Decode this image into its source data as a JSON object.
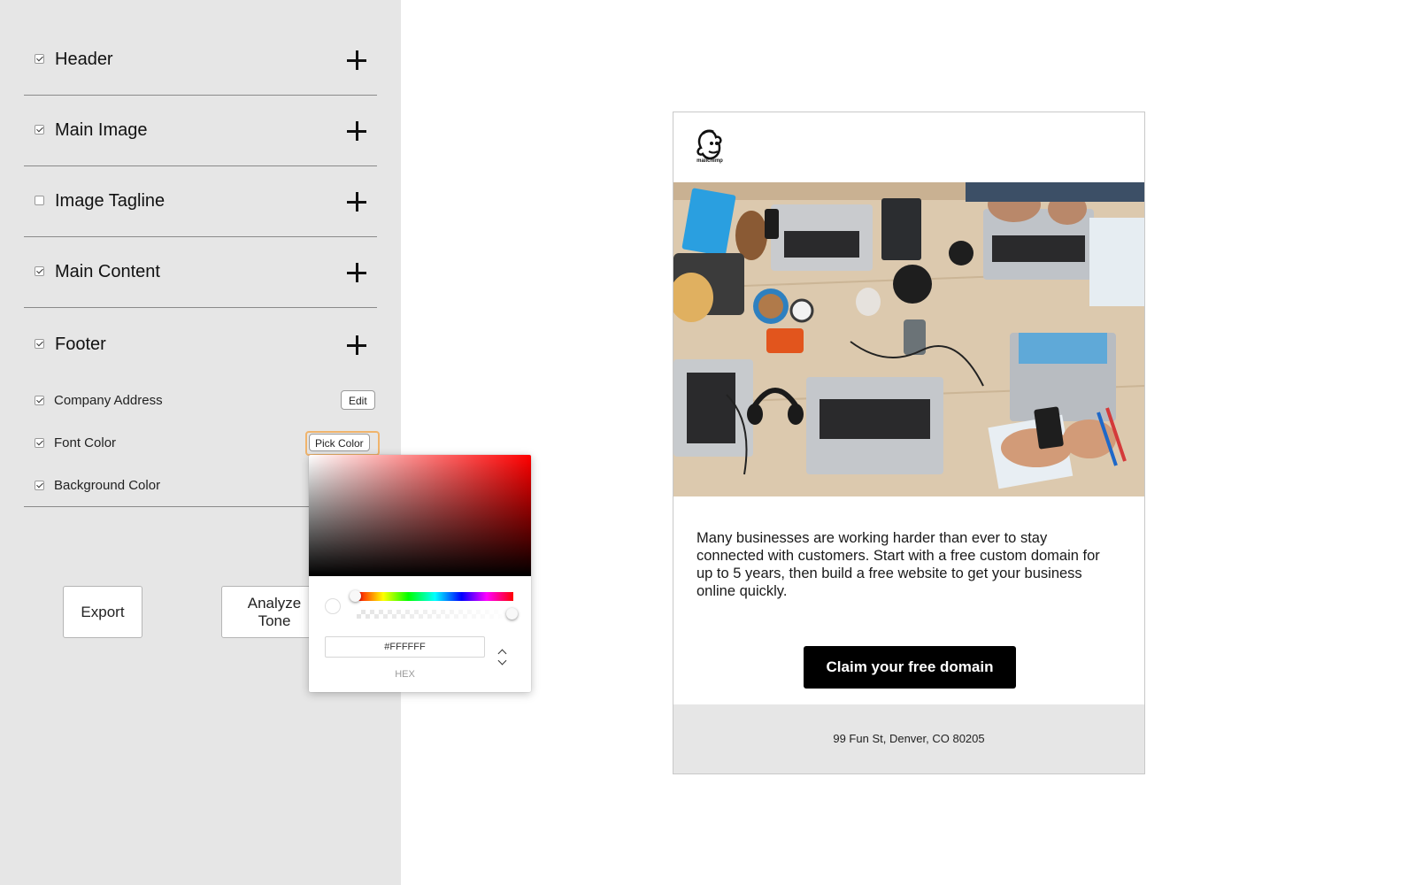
{
  "sidebar": {
    "sections": [
      {
        "label": "Header",
        "checked": true
      },
      {
        "label": "Main Image",
        "checked": true
      },
      {
        "label": "Image Tagline",
        "checked": false
      },
      {
        "label": "Main Content",
        "checked": true
      },
      {
        "label": "Footer",
        "checked": true
      }
    ],
    "footer_options": [
      {
        "label": "Company Address",
        "checked": true,
        "button": "Edit"
      },
      {
        "label": "Font Color",
        "checked": true,
        "button": "Pick Color"
      },
      {
        "label": "Background Color",
        "checked": true
      }
    ],
    "export_label": "Export",
    "analyze_label_line1": "Analyze",
    "analyze_label_line2": "Tone"
  },
  "color_picker": {
    "hex_value": "#FFFFFF",
    "hex_caption": "HEX",
    "hue_color": "#FF0000"
  },
  "email": {
    "logo_text": "mailchimp",
    "body_text": "Many businesses are working harder than ever to stay connected with customers. Start with a free custom domain for up to 5 years, then build a free website to get your business online quickly.",
    "cta_label": "Claim your free domain",
    "footer_address": "99 Fun St, Denver, CO 80205"
  }
}
